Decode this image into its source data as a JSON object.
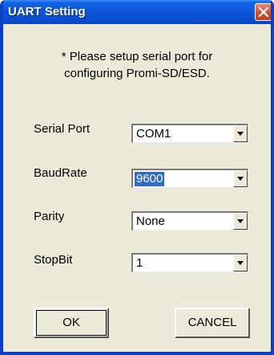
{
  "window": {
    "title": "UART Setting"
  },
  "message": {
    "line1": "* Please setup serial port for",
    "line2": "configuring Promi-SD/ESD."
  },
  "fields": {
    "serial_port": {
      "label": "Serial Port",
      "value": "COM1"
    },
    "baud_rate": {
      "label": "BaudRate",
      "value": "9600"
    },
    "parity": {
      "label": "Parity",
      "value": "None"
    },
    "stop_bit": {
      "label": "StopBit",
      "value": "1"
    }
  },
  "buttons": {
    "ok": "OK",
    "cancel": "CANCEL"
  },
  "icons": {
    "close": "close-icon",
    "dropdown": "chevron-down-icon"
  },
  "colors": {
    "titlebar": "#0a4fd2",
    "dialog_bg": "#ece9d8",
    "selection": "#316ac5",
    "close_button": "#cf4a2c"
  }
}
